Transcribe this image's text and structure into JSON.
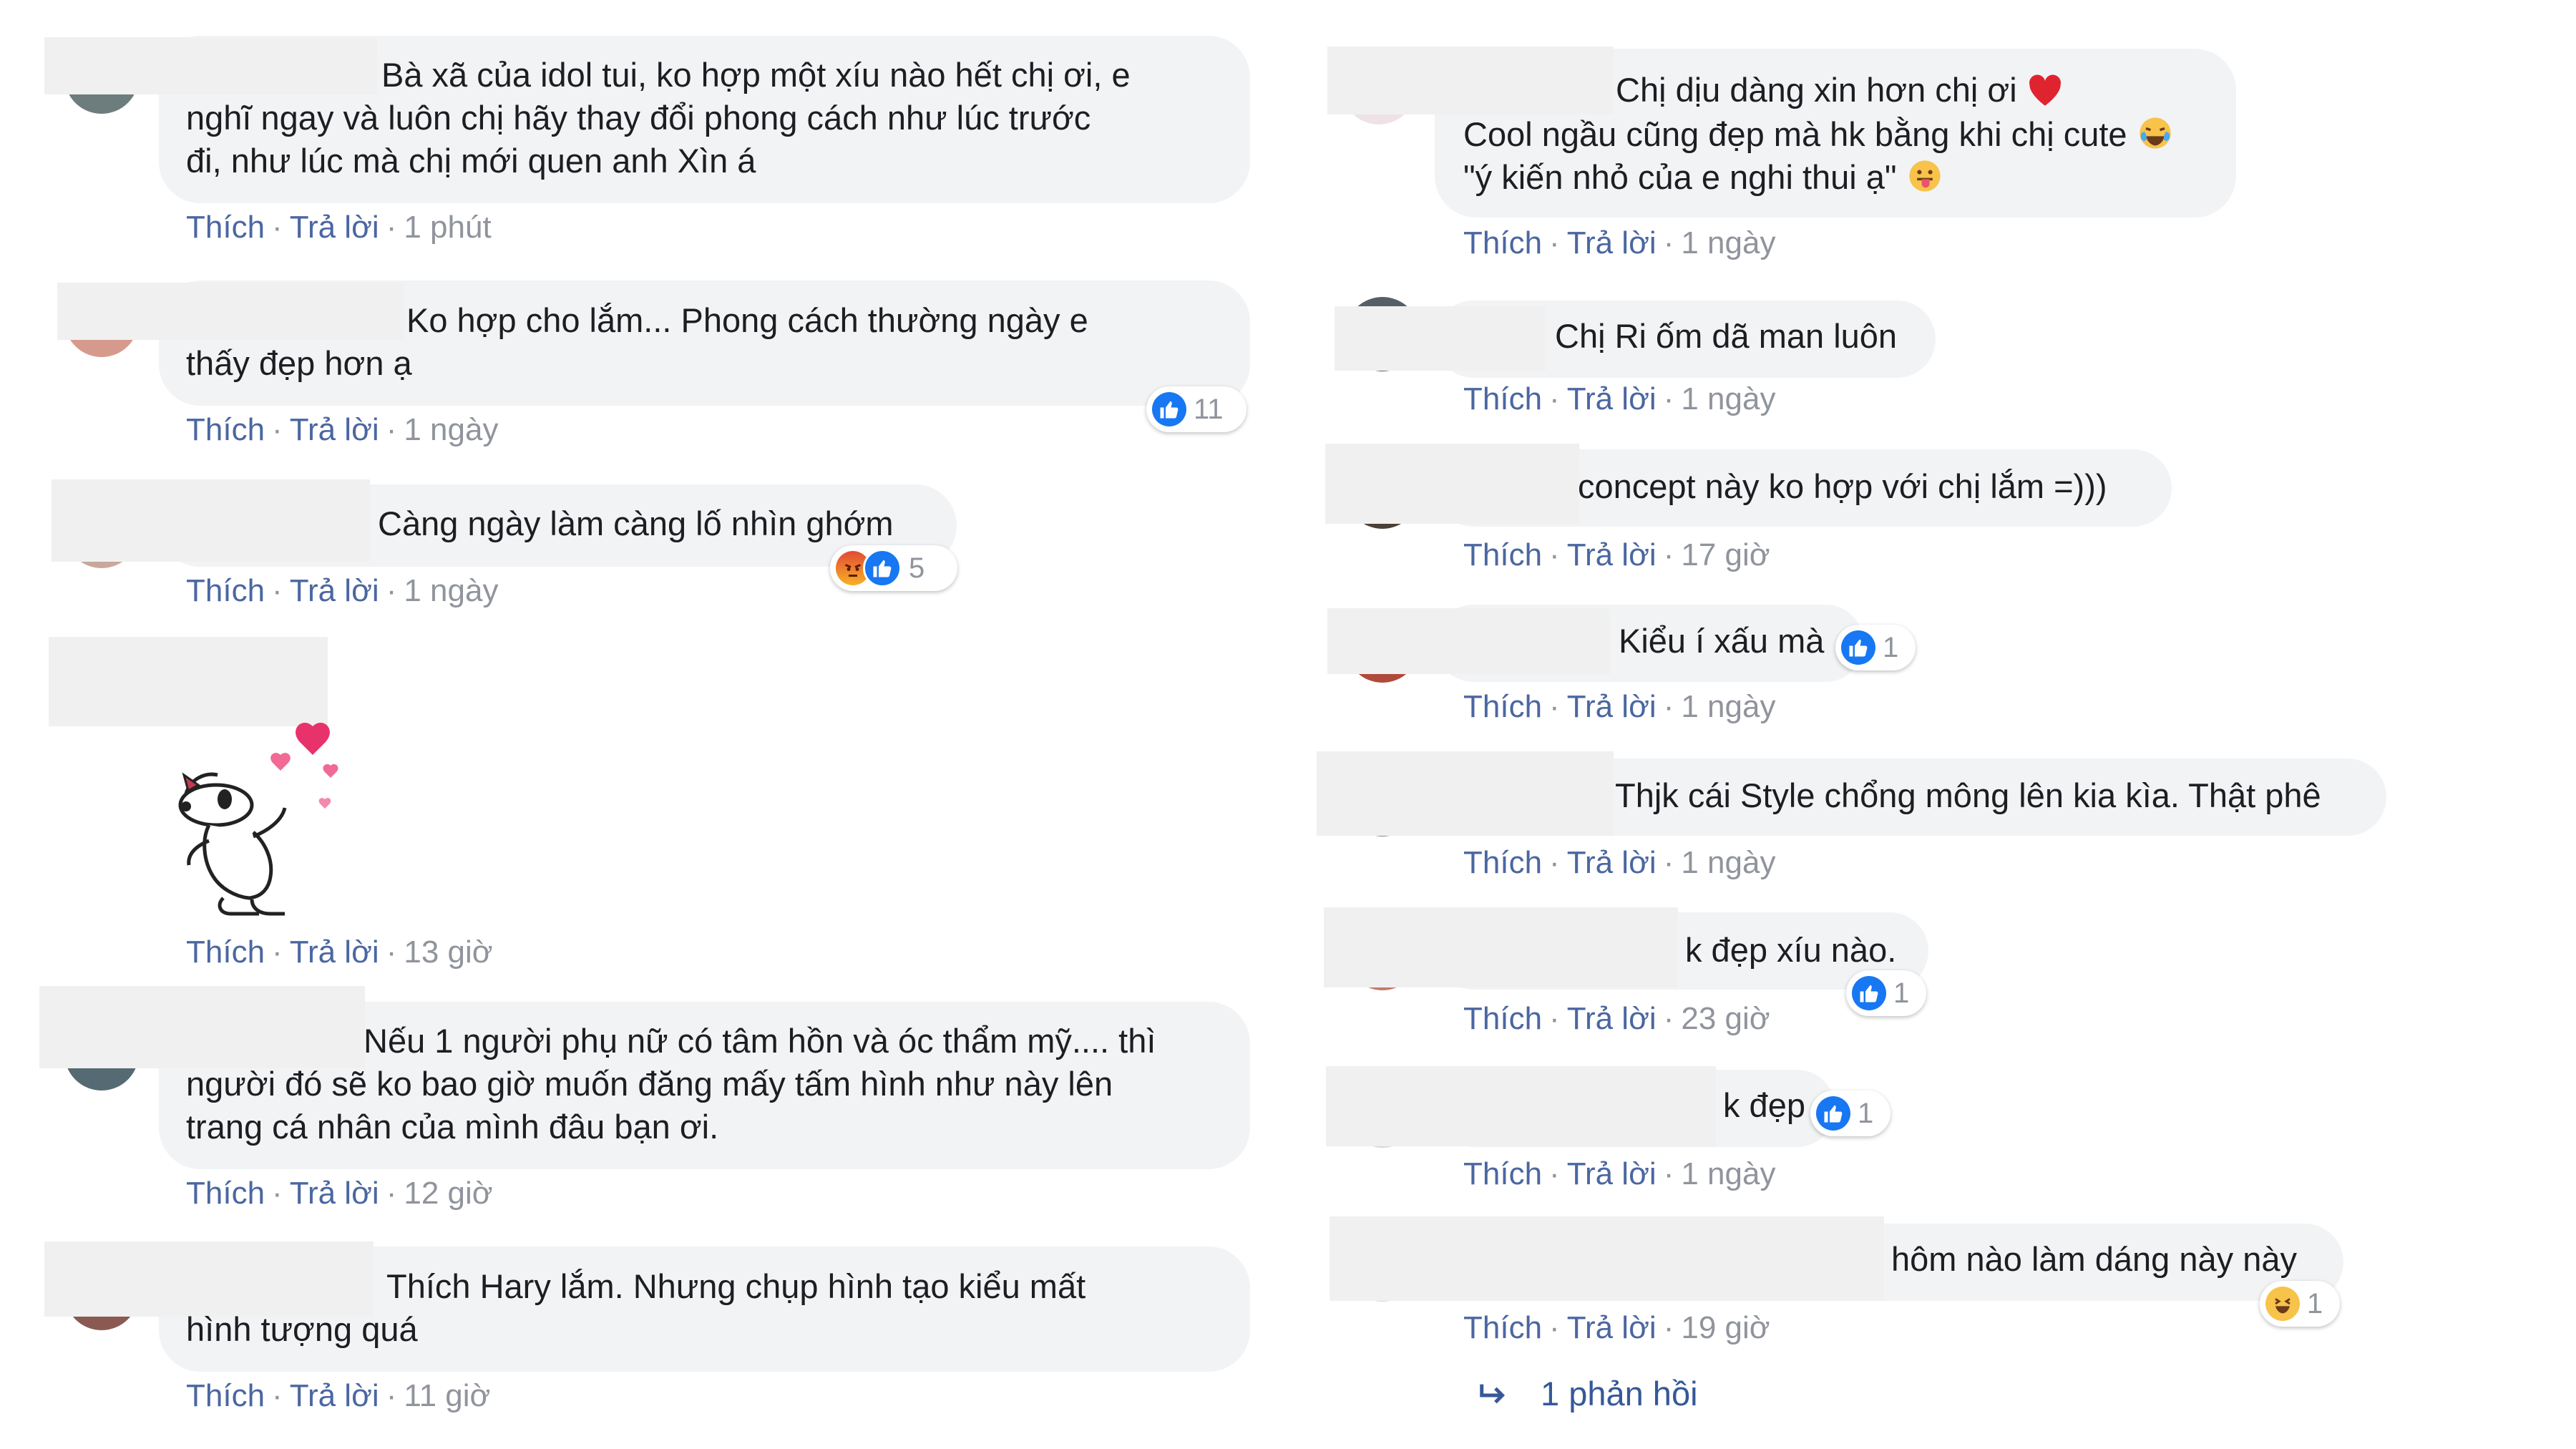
{
  "actions": {
    "like": "Thích",
    "reply": "Trả lời",
    "sep": "·"
  },
  "left_comments": [
    {
      "lines": [
        "Bà xã của idol tui, ko hợp một xíu nào hết chị ơi, e",
        "nghĩ ngay và luôn chị hãy thay đổi phong cách như lúc trước",
        "đi, như lúc mà chị mới quen anh Xìn á"
      ],
      "time": "1 phút"
    },
    {
      "lines": [
        "Ko hợp cho lắm... Phong cách thường ngày e",
        "thấy đẹp hơn ạ"
      ],
      "time": "1 ngày",
      "reactions": {
        "count": "11"
      }
    },
    {
      "lines": [
        "Càng ngày làm càng lố nhìn ghớm"
      ],
      "time": "1 ngày",
      "reactions": {
        "count": "5"
      }
    },
    {
      "lines": [],
      "sticker": "snoopy-hearts-sticker",
      "time": "13 giờ"
    },
    {
      "lines": [
        "Nếu 1 người phụ nữ có tâm hồn và óc thẩm mỹ.... thì",
        "người đó sẽ ko bao giờ muốn đăng mấy tấm hình như này lên",
        "trang cá nhân của mình đâu bạn ơi."
      ],
      "time": "12 giờ"
    },
    {
      "lines": [
        "Thích Hary lắm. Nhưng chụp hình tạo kiểu mất",
        "hình tượng quá"
      ],
      "time": "11 giờ"
    }
  ],
  "right_comments": [
    {
      "lines": [
        "Chị dịu dàng xin hơn chị ơi",
        "Cool ngầu cũng đẹp mà hk bằng khi chị cute",
        "\"ý kiến nhỏ của e nghi thui ạ\""
      ],
      "emojis": [
        "heart-emoji",
        "tears-of-joy-emoji",
        "tongue-out-emoji"
      ],
      "time": "1 ngày"
    },
    {
      "lines": [
        "Chị Ri ốm dã man luôn"
      ],
      "time": "1 ngày"
    },
    {
      "lines": [
        "concept này ko hợp với chị lắm =)))"
      ],
      "time": "17 giờ"
    },
    {
      "lines": [
        "Kiểu í xấu mà"
      ],
      "time": "1 ngày",
      "reactions": {
        "count": "1"
      }
    },
    {
      "lines": [
        "Thjk cái Style chổng mông lên kia kìa. Thật phê"
      ],
      "time": "1 ngày"
    },
    {
      "lines": [
        "k đẹp xíu nào."
      ],
      "time": "23 giờ",
      "reactions": {
        "count": "1"
      }
    },
    {
      "lines": [
        "k đẹp"
      ],
      "time": "1 ngày",
      "reactions": {
        "count": "1"
      }
    },
    {
      "lines": [
        "hôm nào làm dáng này này"
      ],
      "time": "19 giờ",
      "reactions": {
        "count": "1"
      }
    }
  ],
  "replies_link": "1 phản hồi",
  "colors": {
    "bubble": "#f2f3f5",
    "link": "#4b67a1",
    "meta": "#90949c",
    "like_blue": "#1877f2"
  }
}
